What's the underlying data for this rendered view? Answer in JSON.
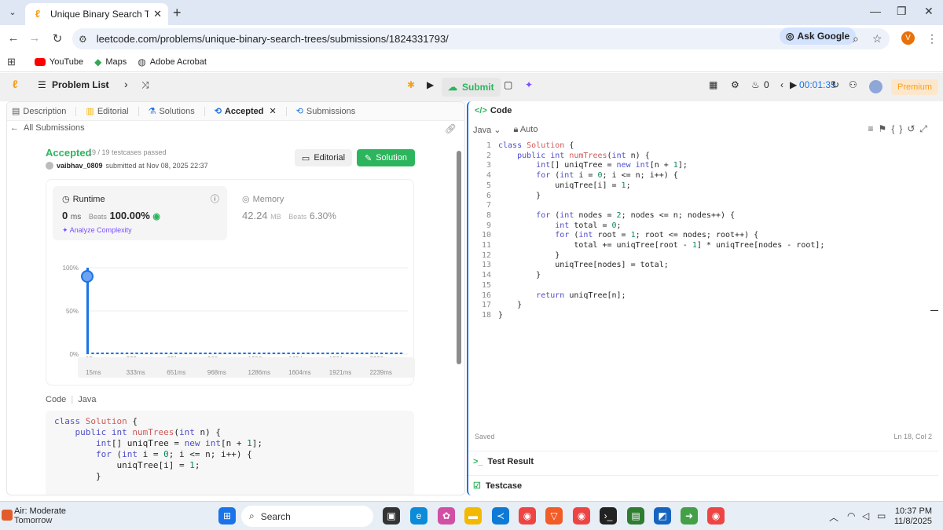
{
  "browser": {
    "tab_title": "Unique Binary Search Trees - Le",
    "url": "leetcode.com/problems/unique-binary-search-trees/submissions/1824331793/",
    "ask_google": "Ask Google",
    "profile_initial": "V",
    "bookmarks": [
      "YouTube",
      "Maps",
      "Adobe Acrobat"
    ]
  },
  "header": {
    "problem_list": "Problem List",
    "submit": "Submit",
    "streak": "0",
    "timer": "00:01:35",
    "premium": "Premium"
  },
  "left_tabs": [
    "Description",
    "Editorial",
    "Solutions",
    "Accepted",
    "Submissions"
  ],
  "submission": {
    "all_submissions": "All Submissions",
    "status": "Accepted",
    "testcases": "19 / 19 testcases passed",
    "user": "vaibhav_0809",
    "submitted_at": "submitted at Nov 08, 2025 22:37",
    "editorial_btn": "Editorial",
    "solution_btn": "Solution",
    "runtime_label": "Runtime",
    "runtime_value": "0",
    "runtime_unit": "ms",
    "runtime_beats_label": "Beats",
    "runtime_beats": "100.00%",
    "analyze": "Analyze Complexity",
    "memory_label": "Memory",
    "memory_value": "42.24",
    "memory_unit": "MB",
    "memory_beats_label": "Beats",
    "memory_beats": "6.30%",
    "code_label": "Code",
    "code_lang": "Java"
  },
  "chart_data": {
    "type": "bar",
    "title": "",
    "xlabel": "",
    "ylabel": "",
    "y_ticks": [
      "100%",
      "50%",
      "0%"
    ],
    "x_ticks": [
      "15ms",
      "333ms",
      "651ms",
      "968ms",
      "1286ms",
      "1604ms",
      "1921ms",
      "2239ms"
    ],
    "ylim": [
      0,
      100
    ],
    "highlight": {
      "x": "15ms",
      "value": 100
    },
    "bar_count": 65,
    "baseline_value": 0.5,
    "color": "#1a73e8"
  },
  "submitted_code": [
    "class Solution {",
    "    public int numTrees(int n) {",
    "        int[] uniqTree = new int[n + 1];",
    "        for (int i = 0; i <= n; i++) {",
    "            uniqTree[i] = 1;",
    "        }",
    "",
    "        for (int nodes = 2; nodes <= n; nodes++) {"
  ],
  "editor": {
    "title": "Code",
    "lang": "Java",
    "mode": "Auto",
    "saved": "Saved",
    "cursor": "Ln 18, Col 2",
    "test_result": "Test Result",
    "testcase": "Testcase",
    "lines": [
      "class Solution {",
      "    public int numTrees(int n) {",
      "        int[] uniqTree = new int[n + 1];",
      "        for (int i = 0; i <= n; i++) {",
      "            uniqTree[i] = 1;",
      "        }",
      "",
      "        for (int nodes = 2; nodes <= n; nodes++) {",
      "            int total = 0;",
      "            for (int root = 1; root <= nodes; root++) {",
      "                total += uniqTree[root - 1] * uniqTree[nodes - root];",
      "            }",
      "            uniqTree[nodes] = total;",
      "        }",
      "",
      "        return uniqTree[n];",
      "    }",
      "}"
    ]
  },
  "taskbar": {
    "weather_title": "Air: Moderate",
    "weather_sub": "Tomorrow",
    "search": "Search",
    "time": "10:37 PM",
    "date": "11/8/2025"
  }
}
